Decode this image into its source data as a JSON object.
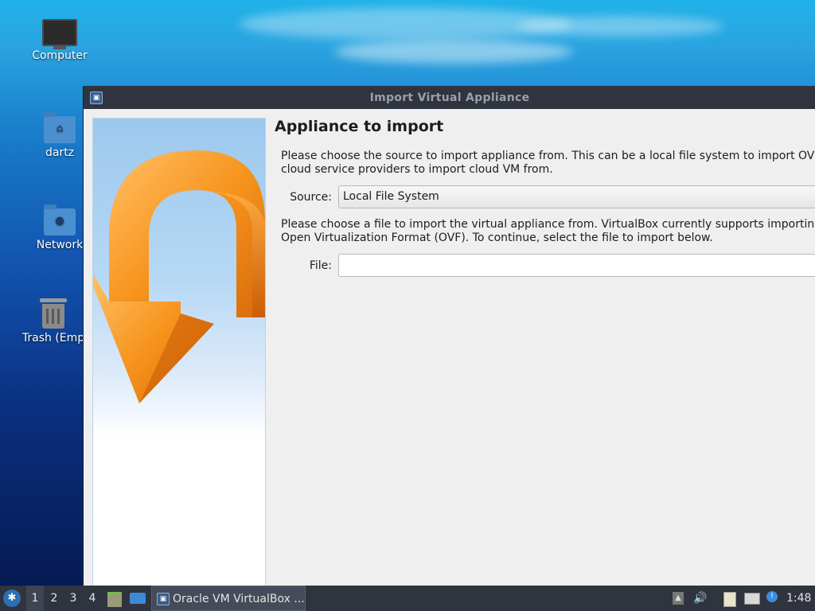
{
  "desktop": {
    "icons": [
      {
        "label": "Computer",
        "icon": "computer-icon"
      },
      {
        "label": "dartz",
        "icon": "home-folder-icon"
      },
      {
        "label": "Network",
        "icon": "network-folder-icon"
      },
      {
        "label": "Trash (Emp",
        "icon": "trash-icon"
      }
    ]
  },
  "window": {
    "title": "Import Virtual Appliance",
    "heading": "Appliance to import",
    "intro_line1": "Please choose the source to import appliance from. This can be a local file system to import OVF arc",
    "intro_line2": "cloud service providers to import cloud VM from.",
    "source_label": "Source:",
    "source_value": "Local File System",
    "file_help_line1": "Please choose a file to import the virtual appliance from. VirtualBox currently supports importing ap",
    "file_help_line2": "Open Virtualization Format (OVF). To continue, select the file to import below.",
    "file_label": "File:",
    "file_value": ""
  },
  "taskbar": {
    "workspaces": [
      "1",
      "2",
      "3",
      "4"
    ],
    "active_workspace": "1",
    "task_label": "Oracle VM VirtualBox ...",
    "clock": "1:48"
  },
  "colors": {
    "titlebar": "#2f343f",
    "taskbar": "#2f343f",
    "dialog_bg": "#efefef",
    "arrow_orange": "#f08a1c"
  }
}
